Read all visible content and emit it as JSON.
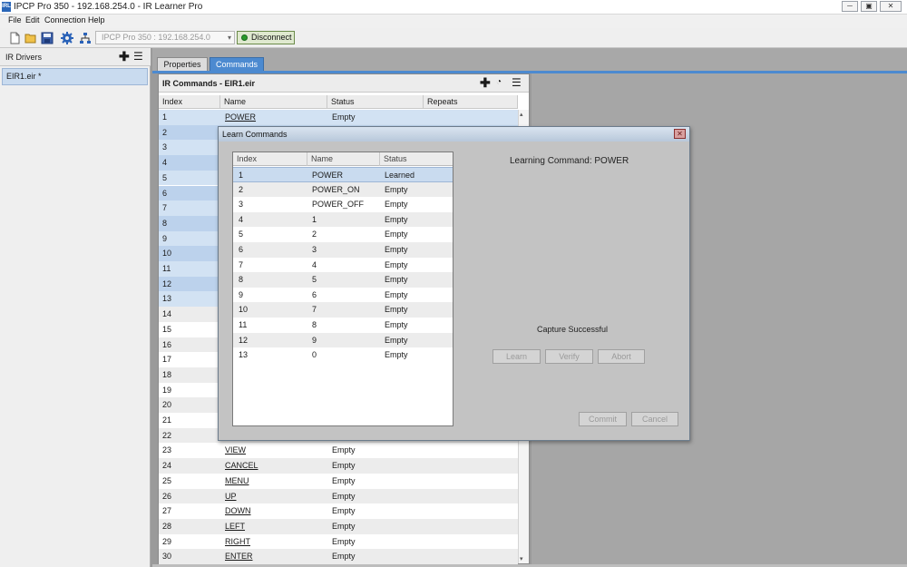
{
  "window": {
    "app_icon": "IRL",
    "title": "IPCP Pro 350 - 192.168.254.0 - IR Learner Pro",
    "minimize": "─",
    "maximize": "▣",
    "close": "✕"
  },
  "menu": [
    "File",
    "Edit",
    "Connection",
    "Help"
  ],
  "toolbar": {
    "device_select_value": "IPCP Pro 350 : 192.168.254.0",
    "disconnect_label": "Disconnect",
    "icons": [
      "new-file-icon",
      "open-folder-icon",
      "save-icon",
      "gear-icon",
      "network-icon"
    ]
  },
  "left_panel": {
    "title": "IR Drivers",
    "add_symbol": "✚",
    "menu_symbol": "☰",
    "items": [
      "EIR1.eir *"
    ]
  },
  "tabs": [
    {
      "label": "Properties"
    },
    {
      "label": "Commands",
      "active": true
    }
  ],
  "commands": {
    "title": "IR Commands - EIR1.eir",
    "add_symbol": "✚",
    "signal_symbol": "◔",
    "menu_symbol": "☰",
    "columns": [
      "Index",
      "Name",
      "Status",
      "Repeats"
    ],
    "rows": [
      {
        "index": "1",
        "name": "POWER",
        "status": "Empty"
      },
      {
        "index": "2",
        "name": "",
        "status": ""
      },
      {
        "index": "3",
        "name": "",
        "status": ""
      },
      {
        "index": "4",
        "name": "",
        "status": ""
      },
      {
        "index": "5",
        "name": "",
        "status": ""
      },
      {
        "index": "6",
        "name": "",
        "status": ""
      },
      {
        "index": "7",
        "name": "",
        "status": ""
      },
      {
        "index": "8",
        "name": "",
        "status": ""
      },
      {
        "index": "9",
        "name": "",
        "status": ""
      },
      {
        "index": "10",
        "name": "",
        "status": ""
      },
      {
        "index": "11",
        "name": "",
        "status": ""
      },
      {
        "index": "12",
        "name": "",
        "status": ""
      },
      {
        "index": "13",
        "name": "",
        "status": ""
      },
      {
        "index": "14",
        "name": "",
        "status": ""
      },
      {
        "index": "15",
        "name": "",
        "status": ""
      },
      {
        "index": "16",
        "name": "",
        "status": ""
      },
      {
        "index": "17",
        "name": "",
        "status": ""
      },
      {
        "index": "18",
        "name": "",
        "status": ""
      },
      {
        "index": "19",
        "name": "",
        "status": ""
      },
      {
        "index": "20",
        "name": "",
        "status": ""
      },
      {
        "index": "21",
        "name": "",
        "status": ""
      },
      {
        "index": "22",
        "name": "",
        "status": ""
      },
      {
        "index": "23",
        "name": "VIEW",
        "status": "Empty"
      },
      {
        "index": "24",
        "name": "CANCEL",
        "status": "Empty"
      },
      {
        "index": "25",
        "name": "MENU",
        "status": "Empty"
      },
      {
        "index": "26",
        "name": "UP",
        "status": "Empty"
      },
      {
        "index": "27",
        "name": "DOWN",
        "status": "Empty"
      },
      {
        "index": "28",
        "name": "LEFT",
        "status": "Empty"
      },
      {
        "index": "29",
        "name": "RIGHT",
        "status": "Empty"
      },
      {
        "index": "30",
        "name": "ENTER",
        "status": "Empty"
      }
    ],
    "scroll_up": "▴",
    "scroll_down": "▾"
  },
  "dialog": {
    "title": "Learn Commands",
    "close_symbol": "✕",
    "columns": [
      "Index",
      "Name",
      "Status"
    ],
    "rows": [
      {
        "index": "1",
        "name": "POWER",
        "status": "Learned"
      },
      {
        "index": "2",
        "name": "POWER_ON",
        "status": "Empty"
      },
      {
        "index": "3",
        "name": "POWER_OFF",
        "status": "Empty"
      },
      {
        "index": "4",
        "name": "1",
        "status": "Empty"
      },
      {
        "index": "5",
        "name": "2",
        "status": "Empty"
      },
      {
        "index": "6",
        "name": "3",
        "status": "Empty"
      },
      {
        "index": "7",
        "name": "4",
        "status": "Empty"
      },
      {
        "index": "8",
        "name": "5",
        "status": "Empty"
      },
      {
        "index": "9",
        "name": "6",
        "status": "Empty"
      },
      {
        "index": "10",
        "name": "7",
        "status": "Empty"
      },
      {
        "index": "11",
        "name": "8",
        "status": "Empty"
      },
      {
        "index": "12",
        "name": "9",
        "status": "Empty"
      },
      {
        "index": "13",
        "name": "0",
        "status": "Empty"
      }
    ],
    "learning_label": "Learning Command: POWER",
    "capture_status": "Capture Successful",
    "buttons": {
      "learn": "Learn",
      "verify": "Verify",
      "abort": "Abort",
      "commit": "Commit",
      "cancel": "Cancel"
    }
  },
  "colors": {
    "accent": "#4c8ad0",
    "selection": "#c9dbef",
    "dialog_bg": "#c3c3c3"
  }
}
